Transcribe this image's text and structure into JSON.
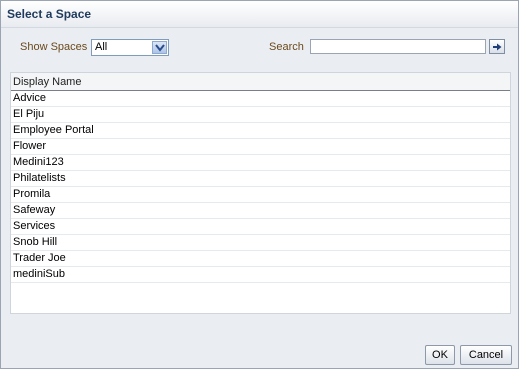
{
  "dialog": {
    "title": "Select a Space"
  },
  "filter": {
    "show_label": "Show Spaces",
    "show_value": "All",
    "search_label": "Search",
    "search_value": "",
    "search_placeholder": ""
  },
  "table": {
    "header": "Display Name",
    "rows": [
      "Advice",
      "El Piju",
      "Employee Portal",
      "Flower",
      "Medini123",
      "Philatelists",
      "Promila",
      "Safeway",
      "Services",
      "Snob Hill",
      "Trader Joe",
      "mediniSub"
    ]
  },
  "buttons": {
    "ok": "OK",
    "cancel": "Cancel"
  },
  "icons": {
    "select_arrow": "chevron-down-icon",
    "search_go": "arrow-right-icon"
  }
}
